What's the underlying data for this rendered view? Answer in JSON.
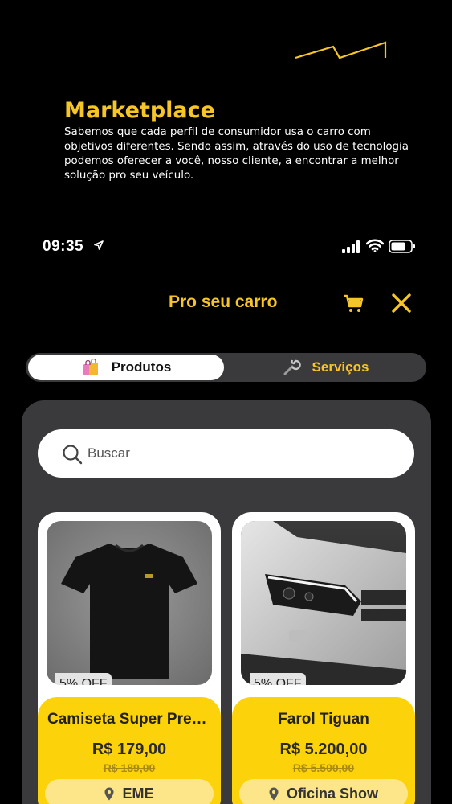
{
  "intro": {
    "title": "Marketplace",
    "description": "Sabemos que cada perfil de consumidor usa o carro com objetivos diferentes. Sendo assim, através do uso de tecnologia podemos oferecer a você, nosso cliente, a encontrar a melhor solução pro seu veículo."
  },
  "status_bar": {
    "time": "09:35"
  },
  "header": {
    "title": "Pro seu carro",
    "cart_icon": "cart-icon",
    "close_icon": "close-icon"
  },
  "tabs": [
    {
      "label": "Produtos",
      "icon": "shopping-bags-icon",
      "selected": true
    },
    {
      "label": "Serviços",
      "icon": "wrench-icon",
      "selected": false
    }
  ],
  "search": {
    "placeholder": "Buscar"
  },
  "products": [
    {
      "discount": "5% OFF",
      "name": "Camiseta Super Premium",
      "price": "R$ 179,00",
      "old_price": "R$ 189,00",
      "store": "EME"
    },
    {
      "discount": "5% OFF",
      "name": "Farol Tiguan",
      "price": "R$ 5.200,00",
      "old_price": "R$ 5.500,00",
      "store": "Oficina Show"
    }
  ],
  "colors": {
    "accent": "#f6c628",
    "card_footer": "#fcd20a",
    "panel": "#3a3a3c",
    "background": "#000000"
  }
}
